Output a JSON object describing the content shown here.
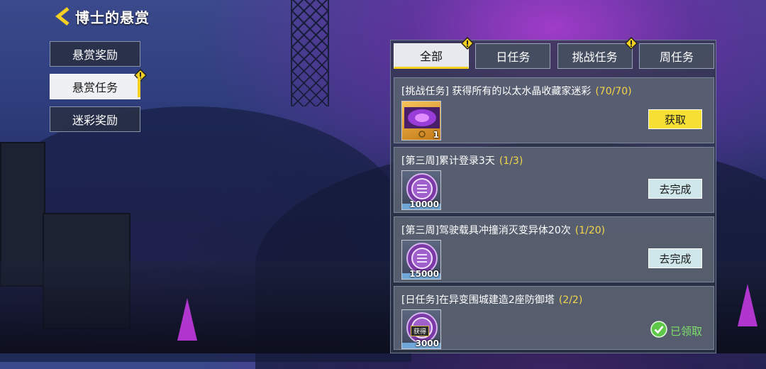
{
  "header": {
    "title": "博士的悬赏"
  },
  "menu": {
    "items": [
      {
        "label": "悬赏奖励",
        "active": false
      },
      {
        "label": "悬赏任务",
        "active": true,
        "alert": true
      },
      {
        "label": "迷彩奖励",
        "active": false
      }
    ]
  },
  "tabs": [
    {
      "label": "全部",
      "active": true,
      "alert": true
    },
    {
      "label": "日任务",
      "active": false,
      "alert": false
    },
    {
      "label": "挑战任务",
      "active": false,
      "alert": true
    },
    {
      "label": "周任务",
      "active": false,
      "alert": false
    }
  ],
  "tasks": [
    {
      "title": "[挑战任务] 获得所有的以太水晶收藏家迷彩",
      "progress": "(70/70)",
      "reward_type": "camo",
      "reward_qty": "1",
      "action": "获取",
      "action_style": "primary"
    },
    {
      "title": "[第三周]累计登录3天",
      "progress": "(1/3)",
      "reward_type": "coin",
      "reward_qty": "10000",
      "action": "去完成",
      "action_style": "secondary"
    },
    {
      "title": "[第三周]驾驶载具冲撞消灭变异体20次",
      "progress": "(1/20)",
      "reward_type": "coin",
      "reward_qty": "15000",
      "action": "去完成",
      "action_style": "secondary"
    },
    {
      "title": "[日任务]在异变围城建造2座防御塔",
      "progress": "(2/2)",
      "reward_type": "coin",
      "reward_qty": "3000",
      "reward_tag": "获得",
      "action": "已领取",
      "action_style": "claimed"
    }
  ],
  "colors": {
    "accent_yellow": "#f5d020",
    "progress_yellow": "#f5d54a",
    "claimed_green": "#7ee06a"
  },
  "icons": [
    "back-arrow-icon",
    "warning-icon",
    "purple-crystal-icon",
    "coin-icon",
    "check-circle-icon"
  ]
}
